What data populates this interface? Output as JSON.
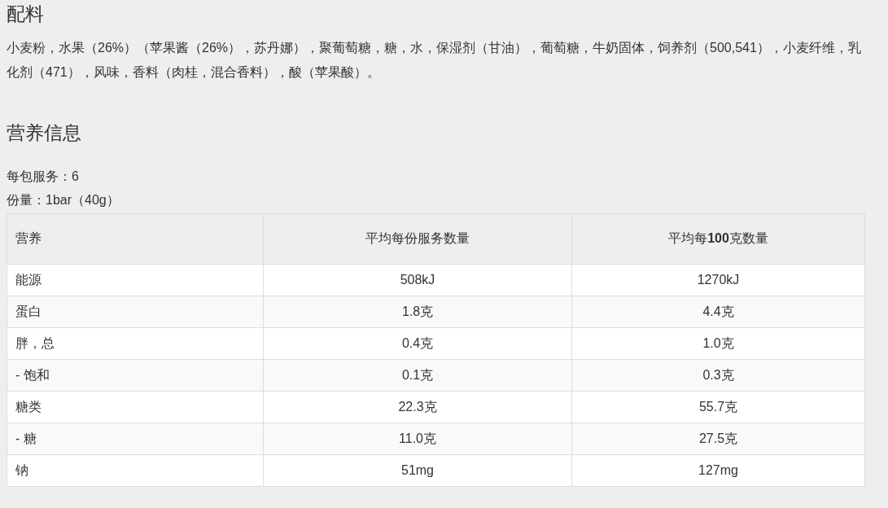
{
  "ingredients": {
    "heading": "配料",
    "text": "小麦粉，水果（26%）（苹果酱（26%），苏丹娜），聚葡萄糖，糖，水，保湿剂（甘油），葡萄糖，牛奶固体，饲养剂（500,541），小麦纤维，乳化剂（471），风味，香料（肉桂，混合香料），酸（苹果酸）。"
  },
  "nutrition": {
    "heading": "营养信息",
    "servings": "每包服务：6",
    "serving_size": "份量：1bar（40g）",
    "table": {
      "columns": [
        "营养",
        "平均每份服务数量",
        "平均每**100**克数量"
      ],
      "rows": [
        {
          "cells": [
            "能源",
            "508kJ",
            "1270kJ"
          ]
        },
        {
          "cells": [
            "蛋白",
            "1.8克",
            "4.4克"
          ]
        },
        {
          "cells": [
            "胖，总",
            "0.4克",
            "1.0克"
          ]
        },
        {
          "cells": [
            "- 饱和",
            "0.1克",
            "0.3克"
          ]
        },
        {
          "cells": [
            "糖类",
            "22.3克",
            "55.7克"
          ]
        },
        {
          "cells": [
            "- 糖",
            "11.0克",
            "27.5克"
          ]
        },
        {
          "cells": [
            "钠",
            "51mg",
            "127mg"
          ]
        }
      ]
    }
  }
}
